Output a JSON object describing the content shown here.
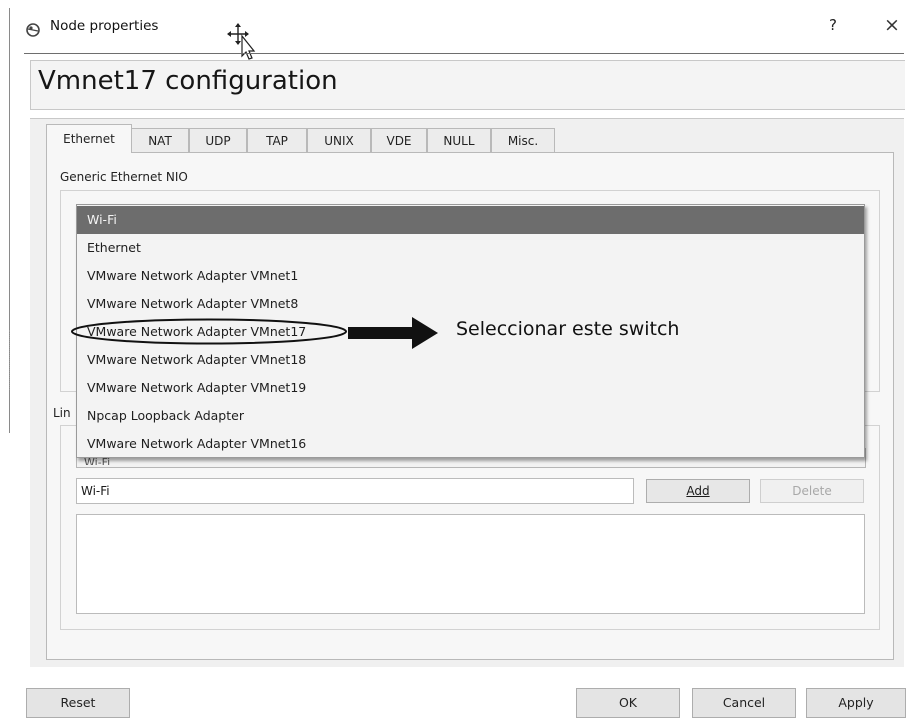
{
  "window": {
    "title": "Node properties",
    "help_glyph": "?",
    "close_glyph": "×"
  },
  "header": {
    "title": "Vmnet17 configuration"
  },
  "tabs": [
    {
      "label": "Ethernet",
      "active": true
    },
    {
      "label": "NAT",
      "active": false
    },
    {
      "label": "UDP",
      "active": false
    },
    {
      "label": "TAP",
      "active": false
    },
    {
      "label": "UNIX",
      "active": false
    },
    {
      "label": "VDE",
      "active": false
    },
    {
      "label": "NULL",
      "active": false
    },
    {
      "label": "Misc.",
      "active": false
    }
  ],
  "ethernet": {
    "group_label": "Generic Ethernet NIO",
    "link_label_partial": "Lin",
    "behind_combo_partial": "Wi-Fi",
    "dropdown_options": [
      "Wi-Fi",
      "Ethernet",
      "VMware Network Adapter VMnet1",
      "VMware Network Adapter VMnet8",
      "VMware Network Adapter VMnet17",
      "VMware Network Adapter VMnet18",
      "VMware Network Adapter VMnet19",
      "Npcap Loopback Adapter",
      "VMware Network Adapter VMnet16"
    ],
    "selected_option": "Wi-Fi",
    "input_value": "Wi-Fi",
    "add_label": "Add",
    "delete_label": "Delete"
  },
  "annotation": {
    "text": "Seleccionar este switch"
  },
  "buttons": {
    "reset": "Reset",
    "ok": "OK",
    "cancel": "Cancel",
    "apply": "Apply"
  },
  "colors": {
    "selected_option_bg": "#6d6d6d",
    "dialog_bg": "#f0f0f0"
  },
  "icons": [
    "app-icon",
    "move-cursor-icon",
    "help-icon",
    "close-icon",
    "arrow-right-icon"
  ]
}
